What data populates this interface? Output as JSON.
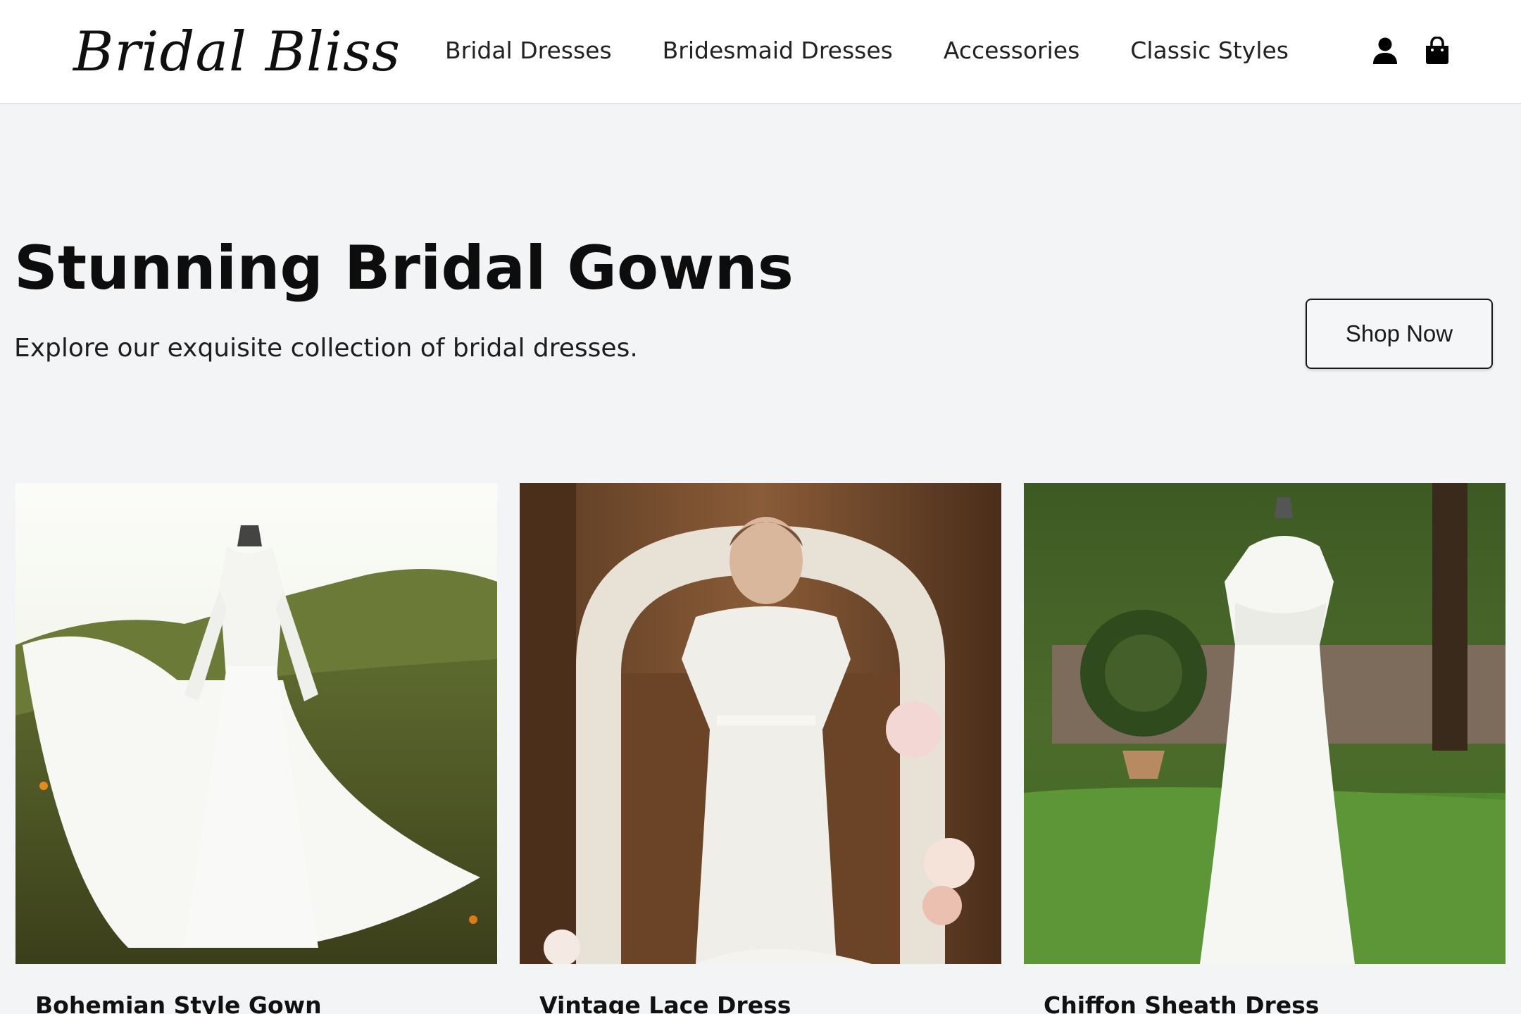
{
  "brand": {
    "logo_text": "Bridal Bliss"
  },
  "nav": {
    "items": [
      {
        "label": "Bridal Dresses"
      },
      {
        "label": "Bridesmaid Dresses"
      },
      {
        "label": "Accessories"
      },
      {
        "label": "Classic Styles"
      }
    ]
  },
  "header_icons": [
    "user-icon",
    "shopping-bag-icon"
  ],
  "hero": {
    "title": "Stunning Bridal Gowns",
    "subtitle": "Explore our exquisite collection of bridal dresses.",
    "cta_label": "Shop Now"
  },
  "products": [
    {
      "name": "Bohemian Style Gown"
    },
    {
      "name": "Vintage Lace Dress"
    },
    {
      "name": "Chiffon Sheath Dress"
    }
  ],
  "colors": {
    "header_bg": "#ffffff",
    "page_bg": "#f3f4f6",
    "text": "#111111"
  }
}
